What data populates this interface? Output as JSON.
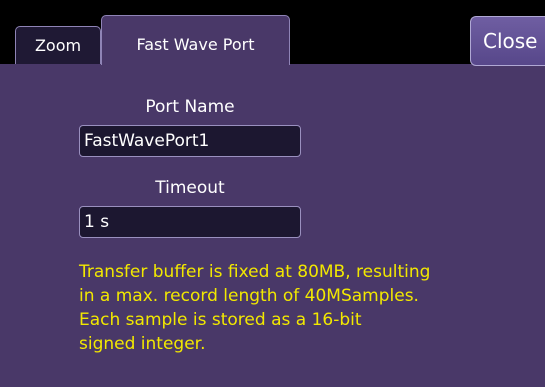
{
  "tabs": [
    {
      "label": "Zoom",
      "active": false
    },
    {
      "label": "Fast Wave Port",
      "active": true
    }
  ],
  "close_label": "Close",
  "port_name": {
    "label": "Port Name",
    "value": "FastWavePort1"
  },
  "timeout": {
    "label": "Timeout",
    "value": "1 s"
  },
  "note_lines": [
    "Transfer buffer is fixed at 80MB, resulting",
    "in a max. record length of 40MSamples.",
    "Each sample is stored as a 16-bit",
    "signed integer."
  ],
  "colors": {
    "background": "#000000",
    "panel": "#493868",
    "inactive_tab": "#1f1934",
    "field": "#1c1730",
    "note_text": "#f2e800"
  }
}
